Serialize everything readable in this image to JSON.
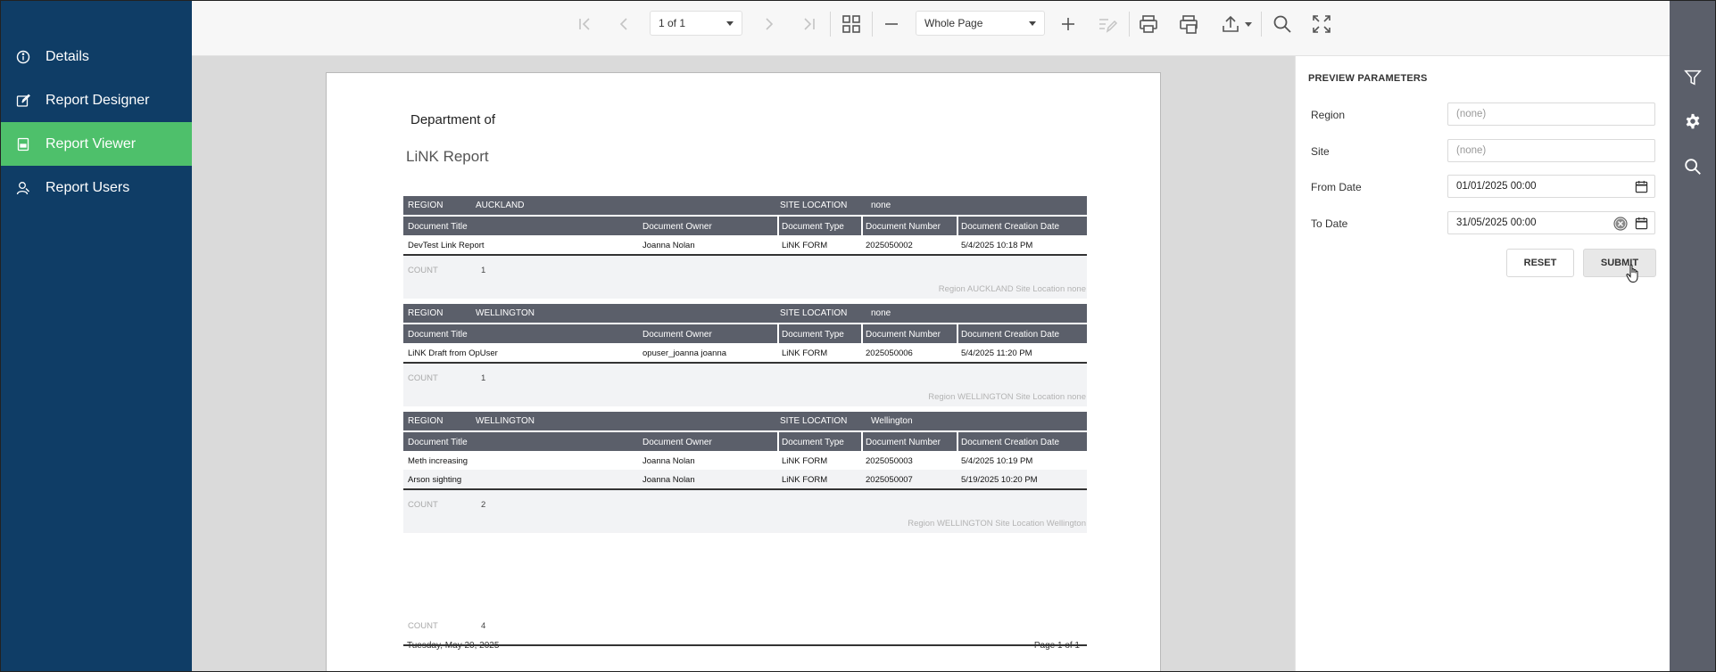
{
  "sidebar": {
    "items": [
      {
        "label": "Details",
        "icon": "info-icon",
        "active": false
      },
      {
        "label": "Report Designer",
        "icon": "edit-icon",
        "active": false
      },
      {
        "label": "Report Viewer",
        "icon": "report-icon",
        "active": true
      },
      {
        "label": "Report Users",
        "icon": "users-icon",
        "active": false
      }
    ]
  },
  "toolbar": {
    "page_select": "1 of 1",
    "zoom_select": "Whole Page"
  },
  "report": {
    "department": "Department of",
    "title": "LiNK Report",
    "columns": [
      "Document Title",
      "Document Owner",
      "Document Type",
      "Document Number",
      "Document Creation Date"
    ],
    "region_label": "REGION",
    "site_label": "SITE LOCATION",
    "count_label": "COUNT",
    "groups": [
      {
        "region": "AUCKLAND",
        "site": "none",
        "rows": [
          [
            "DevTest Link Report",
            "Joanna Nolan",
            "LiNK FORM",
            "2025050002",
            "5/4/2025 10:18 PM"
          ]
        ],
        "count": "1",
        "summary": "Region AUCKLAND  Site Location none"
      },
      {
        "region": "WELLINGTON",
        "site": "none",
        "rows": [
          [
            "LiNK Draft from OpUser",
            "opuser_joanna joanna",
            "LiNK FORM",
            "2025050006",
            "5/4/2025 11:20 PM"
          ]
        ],
        "count": "1",
        "summary": "Region WELLINGTON  Site Location none"
      },
      {
        "region": "WELLINGTON",
        "site": "Wellington",
        "rows": [
          [
            "Meth increasing",
            "Joanna Nolan",
            "LiNK FORM",
            "2025050003",
            "5/4/2025 10:19 PM"
          ],
          [
            "Arson sighting",
            "Joanna Nolan",
            "LiNK FORM",
            "2025050007",
            "5/19/2025 10:20 PM"
          ]
        ],
        "count": "2",
        "summary": "Region WELLINGTON  Site Location Wellington"
      }
    ],
    "total_count": "4",
    "footer_date": "Tuesday, May 20, 2025",
    "footer_page": "Page 1 of 1"
  },
  "params": {
    "title": "PREVIEW PARAMETERS",
    "region_label": "Region",
    "region_value": "(none)",
    "site_label": "Site",
    "site_value": "(none)",
    "from_label": "From Date",
    "from_value": "01/01/2025 00:00",
    "to_label": "To Date",
    "to_value": "31/05/2025 00:00",
    "reset_label": "RESET",
    "submit_label": "SUBMIT"
  },
  "colors": {
    "sidebar_bg": "#0f3d66",
    "sidebar_active": "#4ec06b",
    "table_header": "#5b5f6a",
    "rail_bg": "#5b5f6a"
  }
}
